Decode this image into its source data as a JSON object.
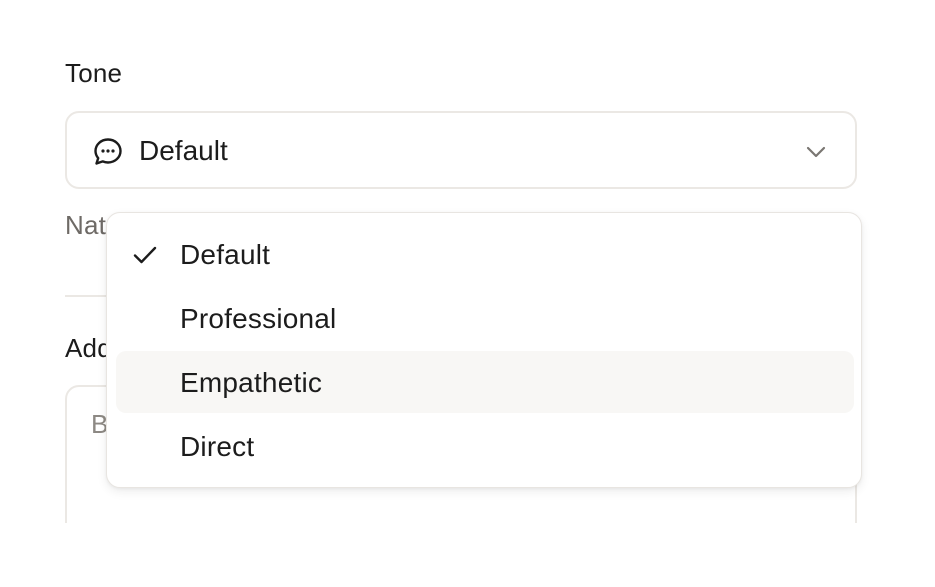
{
  "tone": {
    "label": "Tone",
    "selected_value": "Default",
    "icon": "chat-bubble-icon"
  },
  "behind": {
    "nat_label": "Nat",
    "add_label": "Add",
    "placeholder": "B"
  },
  "dropdown": {
    "items": [
      {
        "label": "Default",
        "checked": true,
        "highlighted": false
      },
      {
        "label": "Professional",
        "checked": false,
        "highlighted": false
      },
      {
        "label": "Empathetic",
        "checked": false,
        "highlighted": true
      },
      {
        "label": "Direct",
        "checked": false,
        "highlighted": false
      }
    ]
  },
  "colors": {
    "border": "#ebe8e4",
    "highlight": "#f8f7f5",
    "text": "#1c1c1c",
    "muted": "#6e6a66"
  }
}
